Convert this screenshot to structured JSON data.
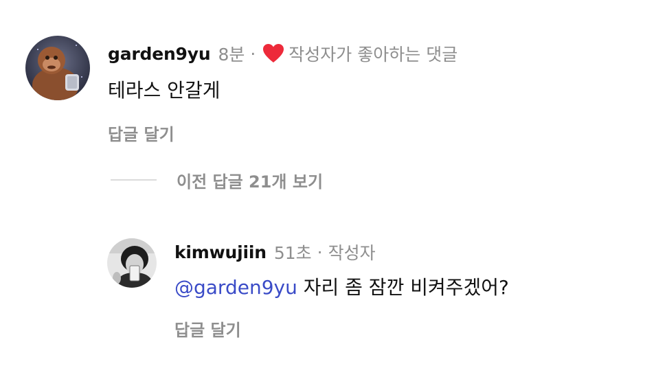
{
  "comment": {
    "username": "garden9yu",
    "time": "8분",
    "separator": "·",
    "liked_by_author_label": "작성자가 좋아하는 댓글",
    "text": "테라스 안갈게",
    "reply_label": "답글 달기",
    "heart_color": "#ed2a3a"
  },
  "view_previous_replies": {
    "label": "이전 답글 21개 보기"
  },
  "reply": {
    "username": "kimwujiin",
    "time": "51초",
    "separator": "·",
    "author_badge": "작성자",
    "mention": "@garden9yu",
    "text": " 자리 좀 잠깐 비켜주겠어?",
    "reply_label": "답글 달기",
    "mention_color": "#3a4bc7"
  }
}
